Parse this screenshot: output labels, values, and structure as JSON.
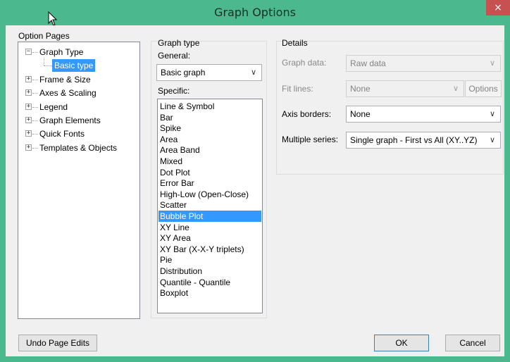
{
  "window": {
    "title": "Graph Options",
    "close_label": "×"
  },
  "option_pages": {
    "heading": "Option Pages",
    "tree": [
      {
        "label": "Graph Type",
        "expander": "−",
        "children": [
          {
            "label": "Basic type",
            "selected": true
          }
        ]
      },
      {
        "label": "Frame & Size",
        "expander": "+"
      },
      {
        "label": "Axes & Scaling",
        "expander": "+"
      },
      {
        "label": "Legend",
        "expander": "+"
      },
      {
        "label": "Graph Elements",
        "expander": "+"
      },
      {
        "label": "Quick Fonts",
        "expander": "+"
      },
      {
        "label": "Templates & Objects",
        "expander": "+"
      }
    ]
  },
  "graph_type": {
    "heading": "Graph type",
    "general_label": "General:",
    "general_value": "Basic graph",
    "specific_label": "Specific:",
    "specific_items": [
      "Line & Symbol",
      "Bar",
      "Spike",
      "Area",
      "Area Band",
      "Mixed",
      "Dot Plot",
      "Error Bar",
      "High-Low (Open-Close)",
      "Scatter",
      "Bubble Plot",
      "XY Line",
      "XY Area",
      "XY Bar (X-X-Y triplets)",
      "Pie",
      "Distribution",
      "Quantile - Quantile",
      "Boxplot"
    ],
    "specific_selected": "Bubble Plot"
  },
  "details": {
    "heading": "Details",
    "graph_data": {
      "label": "Graph data:",
      "value": "Raw data",
      "enabled": false
    },
    "fit_lines": {
      "label": "Fit lines:",
      "value": "None",
      "enabled": false,
      "options_label": "Options"
    },
    "axis_borders": {
      "label": "Axis borders:",
      "value": "None",
      "enabled": true
    },
    "multiple_series": {
      "label": "Multiple series:",
      "value": "Single graph - First vs All (XY..YZ)",
      "enabled": true
    }
  },
  "buttons": {
    "undo": "Undo Page Edits",
    "ok": "OK",
    "cancel": "Cancel"
  },
  "colors": {
    "titlebar": "#4bb88e",
    "selection": "#3399ff",
    "close": "#c75050"
  }
}
